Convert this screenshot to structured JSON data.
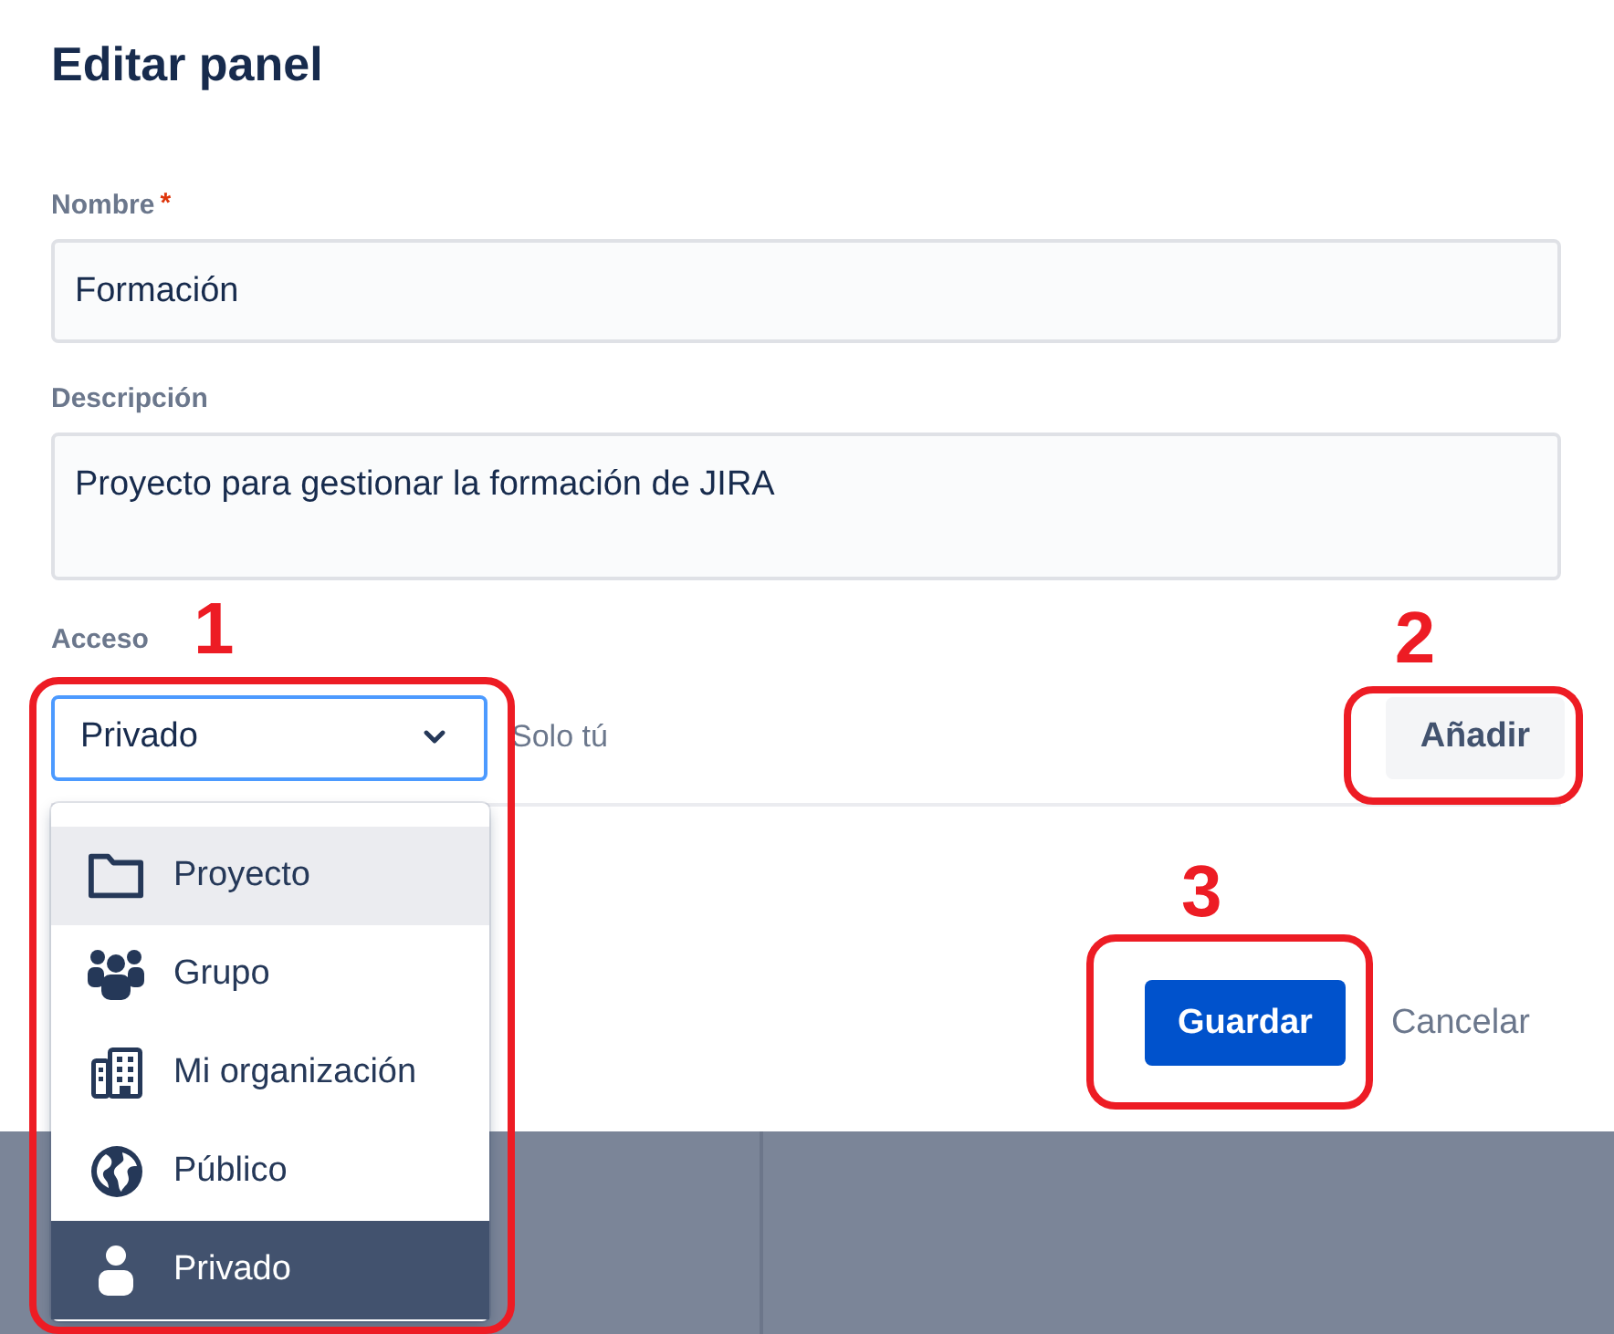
{
  "dialog": {
    "title": "Editar panel"
  },
  "fields": [
    {
      "kind": "input",
      "label": "Nombre",
      "required_mark": "*",
      "value": "Formación"
    },
    {
      "kind": "textarea",
      "label": "Descripción",
      "value": "Proyecto para gestionar la formación de JIRA"
    }
  ],
  "access": {
    "label": "Acceso",
    "select": {
      "value": "Privado",
      "open": true,
      "callout": "1"
    },
    "hint": "Solo tú",
    "add_button": {
      "label": "Añadir",
      "callout": "2"
    },
    "options": [
      {
        "kind": "project",
        "label": "Proyecto",
        "highlighted": true,
        "selected": false
      },
      {
        "kind": "group",
        "label": "Grupo",
        "highlighted": false,
        "selected": false
      },
      {
        "kind": "organization",
        "label": "Mi organización",
        "highlighted": false,
        "selected": false
      },
      {
        "kind": "public",
        "label": "Público",
        "highlighted": false,
        "selected": false
      },
      {
        "kind": "private",
        "label": "Privado",
        "highlighted": false,
        "selected": true
      }
    ]
  },
  "buttons": [
    {
      "kind": "primary",
      "label": "Guardar",
      "callout": "3"
    },
    {
      "kind": "link",
      "label": "Cancelar"
    }
  ]
}
